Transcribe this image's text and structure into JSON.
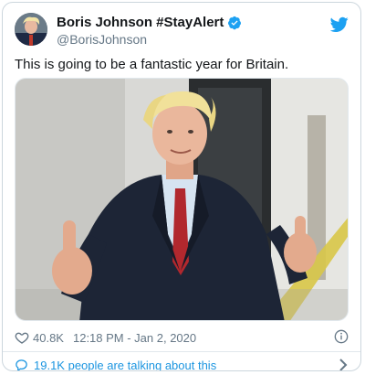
{
  "tweet": {
    "display_name": "Boris Johnson #StayAlert",
    "handle": "@BorisJohnson",
    "text": "This is going to be a fantastic year for Britain.",
    "like_count": "40.8K",
    "timestamp": "12:18 PM - Jan 2, 2020",
    "footer_text": "19.1K people are talking about this",
    "icons": [
      "verified-badge-icon",
      "twitter-bird-icon",
      "heart-icon",
      "info-icon",
      "speech-bubble-icon",
      "chevron-right-icon"
    ],
    "colors": {
      "brand_blue": "#1da1f2",
      "link_blue": "#1b95e0",
      "muted": "#657786",
      "text": "#14171a",
      "border": "#ccd6dd"
    }
  }
}
